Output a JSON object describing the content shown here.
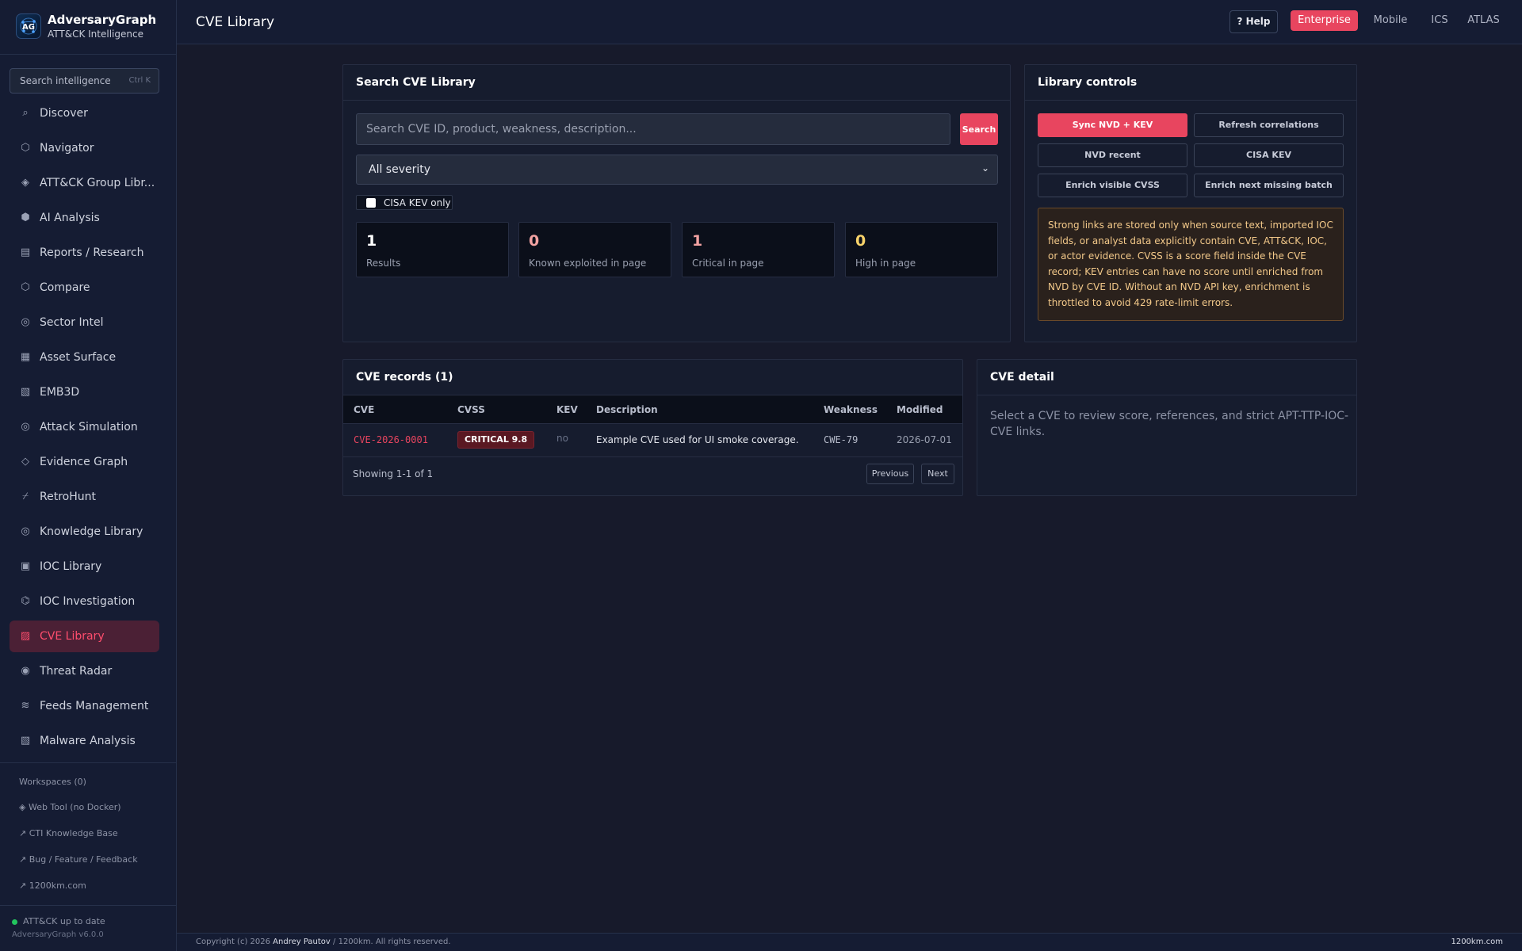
{
  "brand": {
    "title": "AdversaryGraph",
    "subtitle": "ATT&CK Intelligence"
  },
  "sidebar": {
    "search": {
      "placeholder": "Search intelligence",
      "shortcut": "Ctrl K"
    },
    "items": [
      {
        "label": "Discover",
        "icon": "search-icon",
        "glyph": "⌕"
      },
      {
        "label": "Navigator",
        "icon": "hexagon-icon",
        "glyph": "⬡"
      },
      {
        "label": "ATT&CK Group Libr...",
        "icon": "diamond-icon",
        "glyph": "◈"
      },
      {
        "label": "AI Analysis",
        "icon": "hexagon-filled-icon",
        "glyph": "⬢"
      },
      {
        "label": "Reports / Research",
        "icon": "document-icon",
        "glyph": "▤"
      },
      {
        "label": "Compare",
        "icon": "hexagon-icon",
        "glyph": "⬡"
      },
      {
        "label": "Sector Intel",
        "icon": "target-icon",
        "glyph": "◎"
      },
      {
        "label": "Asset Surface",
        "icon": "grid-icon",
        "glyph": "▦"
      },
      {
        "label": "EMB3D",
        "icon": "hatched-square-icon",
        "glyph": "▧"
      },
      {
        "label": "Attack Simulation",
        "icon": "target-icon",
        "glyph": "◎"
      },
      {
        "label": "Evidence Graph",
        "icon": "diamond-outline-icon",
        "glyph": "◇"
      },
      {
        "label": "RetroHunt",
        "icon": "retro-icon",
        "glyph": "⌿"
      },
      {
        "label": "Knowledge Library",
        "icon": "target-icon",
        "glyph": "◎"
      },
      {
        "label": "IOC Library",
        "icon": "square-icon",
        "glyph": "▣"
      },
      {
        "label": "IOC Investigation",
        "icon": "hex-ring-icon",
        "glyph": "⌬"
      },
      {
        "label": "CVE Library",
        "icon": "hatched-square-icon",
        "glyph": "▨",
        "active": true
      },
      {
        "label": "Threat Radar",
        "icon": "radar-icon",
        "glyph": "◉"
      },
      {
        "label": "Feeds Management",
        "icon": "waves-icon",
        "glyph": "≋"
      },
      {
        "label": "Malware Analysis",
        "icon": "hatched-square-icon",
        "glyph": "▧"
      }
    ],
    "workspaces": "Workspaces (0)",
    "links": [
      {
        "label": "◈ Web Tool (no Docker)"
      },
      {
        "label": "↗ CTI Knowledge Base"
      },
      {
        "label": "↗ Bug / Feature / Feedback"
      },
      {
        "label": "↗ 1200km.com"
      }
    ],
    "status": "ATT&CK up to date",
    "version": "AdversaryGraph v6.0.0"
  },
  "header": {
    "title": "CVE Library",
    "help": "? Help",
    "tabs": [
      "Enterprise",
      "Mobile",
      "ICS",
      "ATLAS"
    ],
    "active_tab": "Enterprise"
  },
  "search_panel": {
    "title": "Search CVE Library",
    "placeholder": "Search CVE ID, product, weakness, description...",
    "search_button": "Search",
    "severity": "All severity",
    "kev_only": "CISA KEV only",
    "stats": [
      {
        "value": "1",
        "label": "Results",
        "color": "#ffffff"
      },
      {
        "value": "0",
        "label": "Known exploited in page",
        "color": "#f2a2a2"
      },
      {
        "value": "1",
        "label": "Critical in page",
        "color": "#f2a2a2"
      },
      {
        "value": "0",
        "label": "High in page",
        "color": "#f7d26a"
      }
    ]
  },
  "controls_panel": {
    "title": "Library controls",
    "buttons": [
      "Sync NVD + KEV",
      "Refresh correlations",
      "NVD recent",
      "CISA KEV",
      "Enrich visible CVSS",
      "Enrich next missing batch"
    ],
    "note": "Strong links are stored only when source text, imported IOC fields, or analyst data explicitly contain CVE, ATT&CK, IOC, or actor evidence. CVSS is a score field inside the CVE record; KEV entries can have no score until enriched from NVD by CVE ID. Without an NVD API key, enrichment is throttled to avoid 429 rate-limit errors."
  },
  "records_panel": {
    "title": "CVE records (1)",
    "columns": [
      "CVE",
      "CVSS",
      "KEV",
      "Description",
      "Weakness",
      "Modified"
    ],
    "rows": [
      {
        "cve": "CVE-2026-0001",
        "cvss": "CRITICAL 9.8",
        "kev": "no",
        "description": "Example CVE used for UI smoke coverage.",
        "weakness": "CWE-79",
        "modified": "2026-07-01"
      }
    ],
    "showing": "Showing 1-1 of 1",
    "prev": "Previous",
    "next": "Next"
  },
  "detail_panel": {
    "title": "CVE detail",
    "empty": "Select a CVE to review score, references, and strict APT-TTP-IOC-CVE links."
  },
  "footer": {
    "copyright_prefix": "Copyright (c) 2026",
    "author": "Andrey Pautov",
    "copyright_suffix": "/ 1200km. All rights reserved.",
    "site": "1200km.com"
  },
  "colors": {
    "accent": "#e8455f",
    "background": "#171a2b",
    "sidebar": "#151c33",
    "status_ok": "#22c55e"
  }
}
